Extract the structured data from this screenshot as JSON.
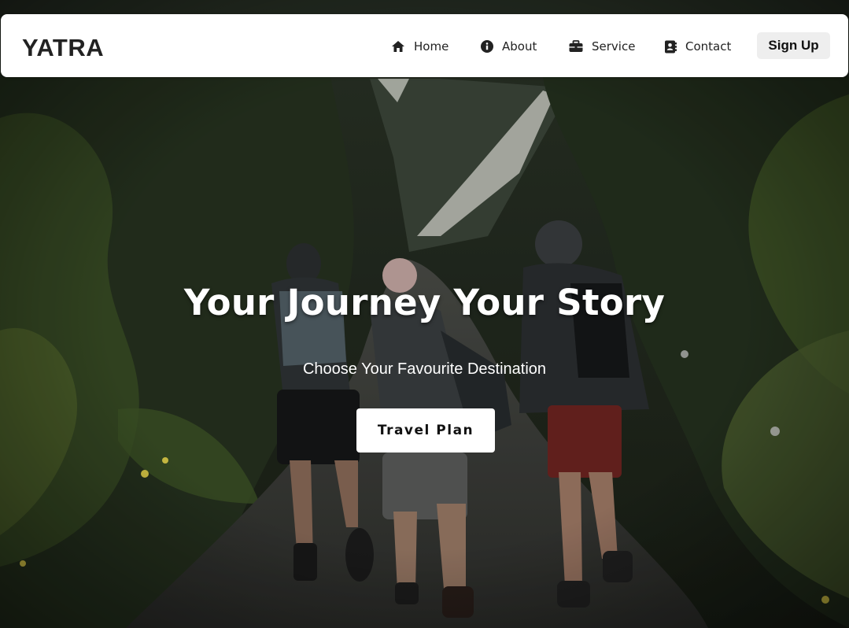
{
  "navbar": {
    "brand": "YATRA",
    "items": [
      {
        "label": "Home",
        "icon": "home-icon"
      },
      {
        "label": "About",
        "icon": "info-circle-icon"
      },
      {
        "label": "Service",
        "icon": "briefcase-icon"
      },
      {
        "label": "Contact",
        "icon": "address-book-icon"
      }
    ],
    "signup_label": "Sign Up"
  },
  "hero": {
    "title": "Your Journey Your Story",
    "subtitle": "Choose Your Favourite Destination",
    "cta_label": "Travel Plan",
    "background_image": "hikers-forest-trail-photo"
  },
  "colors": {
    "navbar_bg": "#ffffff",
    "button_bg": "#ffffff",
    "signup_bg": "#eeeeee",
    "text_dark": "#222222",
    "hero_text": "#ffffff"
  }
}
